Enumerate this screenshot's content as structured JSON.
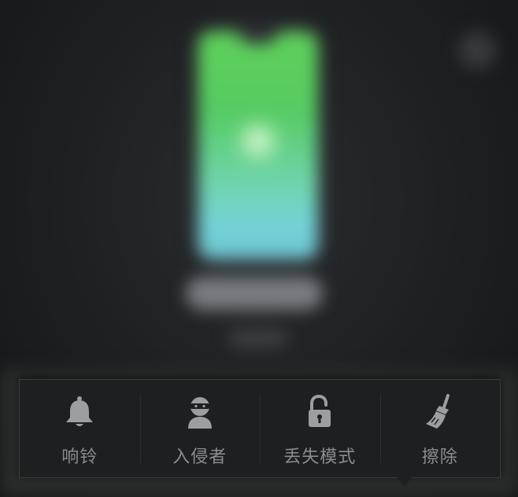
{
  "toolbar": {
    "items": [
      {
        "label": "响铃",
        "icon": "bell-icon"
      },
      {
        "label": "入侵者",
        "icon": "intruder-mask-icon"
      },
      {
        "label": "丢失模式",
        "icon": "unlocked-padlock-icon"
      },
      {
        "label": "擦除",
        "icon": "broom-icon"
      }
    ]
  },
  "colors": {
    "toolbar_bg": "#1e1f20",
    "icon": "#9c9ea1",
    "label": "#8a8c8f",
    "phone_screen_top": "#5fd05a",
    "phone_screen_bottom": "#74d2d8"
  }
}
